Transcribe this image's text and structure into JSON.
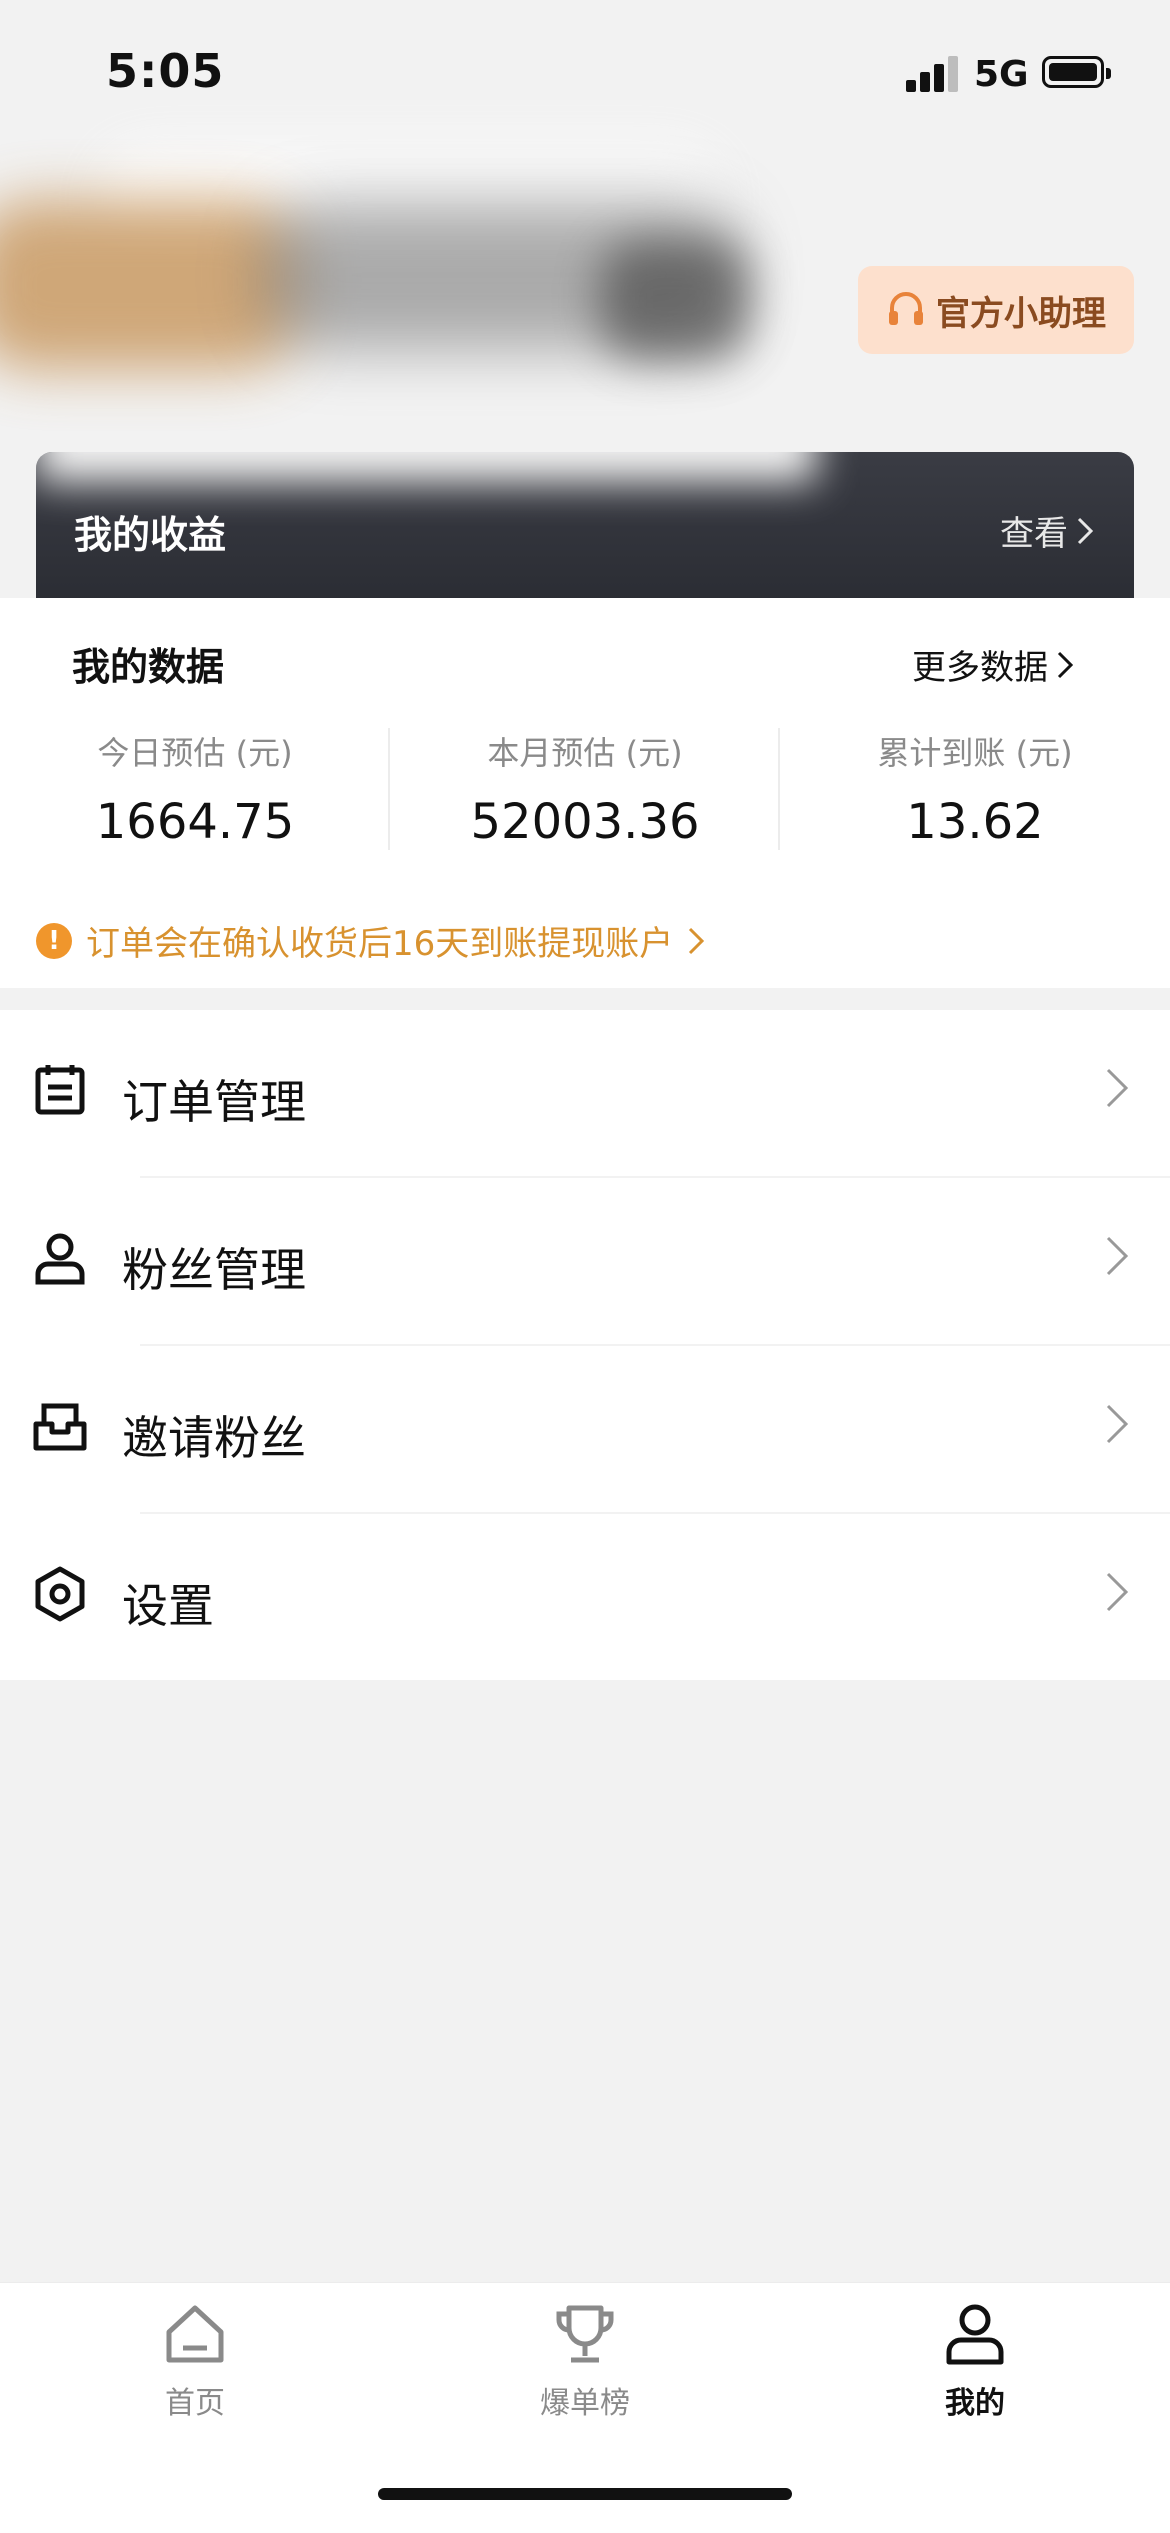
{
  "status_bar": {
    "time": "5:05",
    "network": "5G"
  },
  "header": {
    "assistant_label": "官方小助理"
  },
  "earnings": {
    "title": "我的收益",
    "view_label": "查看"
  },
  "my_data": {
    "title": "我的数据",
    "more_label": "更多数据",
    "stats": [
      {
        "label": "今日预估 (元)",
        "value": "1664.75"
      },
      {
        "label": "本月预估 (元)",
        "value": "52003.36"
      },
      {
        "label": "累计到账 (元)",
        "value": "13.62"
      }
    ],
    "notice": "订单会在确认收货后16天到账提现账户"
  },
  "menu": {
    "items": [
      {
        "label": "订单管理",
        "icon": "clipboard-icon"
      },
      {
        "label": "粉丝管理",
        "icon": "user-icon"
      },
      {
        "label": "邀请粉丝",
        "icon": "inbox-icon"
      },
      {
        "label": "设置",
        "icon": "settings-hexagon-icon"
      }
    ]
  },
  "tabbar": {
    "items": [
      {
        "label": "首页",
        "icon": "home-icon",
        "active": false
      },
      {
        "label": "爆单榜",
        "icon": "trophy-icon",
        "active": false
      },
      {
        "label": "我的",
        "icon": "profile-icon",
        "active": true
      }
    ]
  },
  "colors": {
    "accent_orange": "#f0962c",
    "notice_text": "#d8922f",
    "assistant_bg": "#fde0cd",
    "card_dark": "#2f3138"
  }
}
